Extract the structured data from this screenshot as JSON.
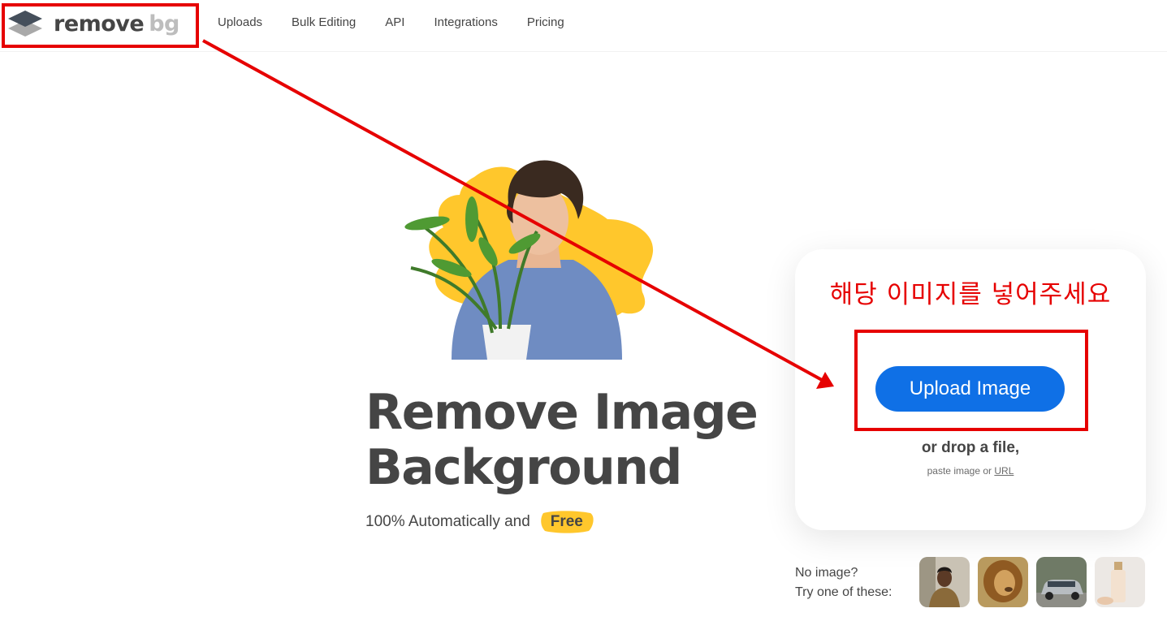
{
  "header": {
    "logo": {
      "word1": "remove",
      "word2": "bg"
    },
    "nav": [
      "Uploads",
      "Bulk Editing",
      "API",
      "Integrations",
      "Pricing"
    ]
  },
  "annotation": {
    "instruction": "해당 이미지를 넣어주세요",
    "color": "#e60000"
  },
  "hero": {
    "title_line1": "Remove Image",
    "title_line2": "Background",
    "subtitle": "100% Automatically and",
    "free_badge": "Free",
    "accent_yellow": "#ffc72c"
  },
  "upload": {
    "button_label": "Upload Image",
    "drop_text": "or drop a file,",
    "paste_text": "paste image or",
    "url_link": "URL",
    "button_color": "#0f70e6"
  },
  "samples": {
    "line1": "No image?",
    "line2": "Try one of these:",
    "items": [
      "person-sample-icon",
      "lion-sample-icon",
      "car-sample-icon",
      "product-sample-icon"
    ]
  }
}
